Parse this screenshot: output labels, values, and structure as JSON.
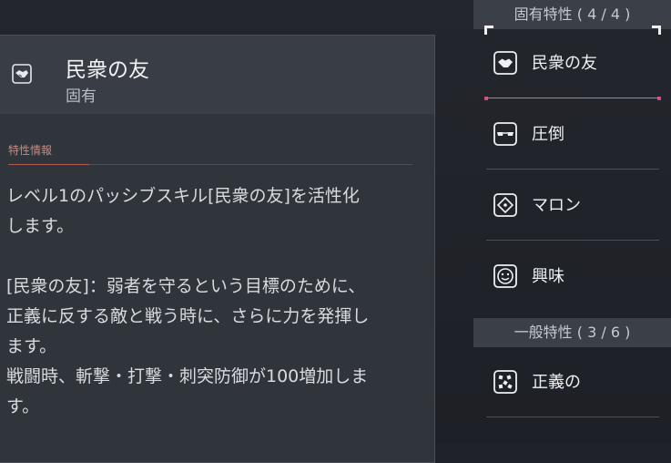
{
  "detail": {
    "icon": "handshake-icon",
    "title": "民衆の友",
    "subtitle": "固有",
    "section_label": "特性情報",
    "lines": [
      "レベル1のパッシブスキル[民衆の友]を活性化",
      "します。",
      "[民衆の友]：弱者を守るという目標のために、",
      "正義に反する敵と戦う時に、さらに力を発揮し",
      "ます。",
      "戦闘時、斬撃・打撃・刺突防御が100増加しま",
      "す。"
    ]
  },
  "categories": [
    {
      "header": "固有特性 ( 4 / 4 )",
      "items": [
        {
          "label": "民衆の友",
          "icon": "handshake-icon",
          "selected": true
        },
        {
          "label": "圧倒",
          "icon": "sunglasses-icon",
          "selected": false
        },
        {
          "label": "マロン",
          "icon": "diamond-arrows-icon",
          "selected": false
        },
        {
          "label": "興味",
          "icon": "smiley-icon",
          "selected": false
        }
      ]
    },
    {
      "header": "一般特性 ( 3 / 6 )",
      "items": [
        {
          "label": "正義の",
          "icon": "scattered-blocks-icon",
          "selected": false
        }
      ]
    }
  ],
  "colors": {
    "accent_pink": "#d04a86",
    "accent_red": "#b45a4e"
  }
}
